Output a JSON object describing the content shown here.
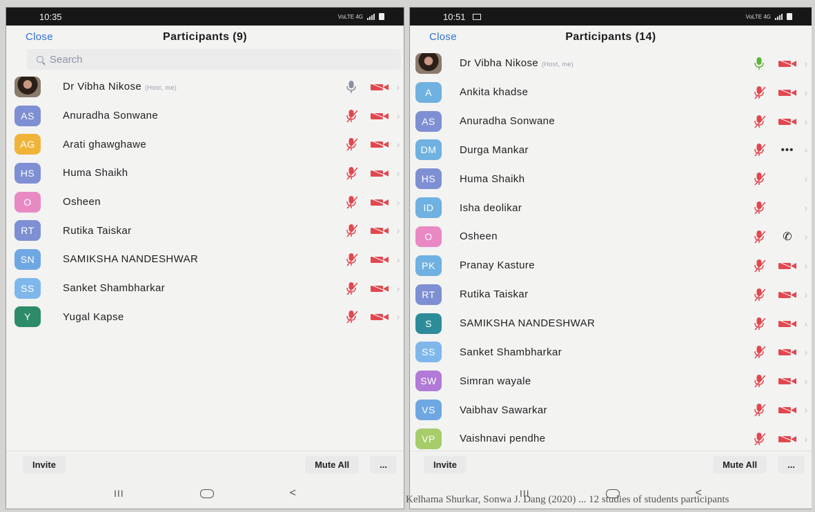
{
  "colors": {
    "accent": "#2f6fd0",
    "muted": "#e2474f",
    "mic_unmuted": "#8a8fa2",
    "mic_active": "#5fb23a"
  },
  "left": {
    "status": {
      "time": "10:35",
      "icons_text": "VoLTE 4G"
    },
    "header": {
      "close": "Close",
      "title": "Participants (9)"
    },
    "search": {
      "placeholder": "Search"
    },
    "participants": [
      {
        "initials": "",
        "photo": true,
        "name": "Dr Vibha Nikose",
        "note": "(Host, me)",
        "mic": "unmuted",
        "cam": true
      },
      {
        "initials": "AS",
        "color": "#7e8fd3",
        "name": "Anuradha Sonwane",
        "mic": "muted",
        "cam": true
      },
      {
        "initials": "AG",
        "color": "#f0b43a",
        "name": "Arati ghawghawe",
        "mic": "muted",
        "cam": true
      },
      {
        "initials": "HS",
        "color": "#7e8fd3",
        "name": "Huma Shaikh",
        "mic": "muted",
        "cam": true
      },
      {
        "initials": "O",
        "color": "#e889c4",
        "name": "Osheen",
        "mic": "muted",
        "cam": true
      },
      {
        "initials": "RT",
        "color": "#7e8fd3",
        "name": "Rutika Taiskar",
        "mic": "muted",
        "cam": true
      },
      {
        "initials": "SN",
        "color": "#6fa7e3",
        "name": "SAMIKSHA NANDESHWAR",
        "mic": "muted",
        "cam": true
      },
      {
        "initials": "SS",
        "color": "#7fb7ea",
        "name": "Sanket Shambharkar",
        "mic": "muted",
        "cam": true
      },
      {
        "initials": "Y",
        "color": "#2e8b6a",
        "name": "Yugal Kapse",
        "mic": "muted",
        "cam": true
      }
    ],
    "bottom": {
      "invite": "Invite",
      "mute_all": "Mute All",
      "more": "..."
    },
    "nav": {
      "recents": "III",
      "back": "<"
    }
  },
  "right": {
    "status": {
      "time": "10:51",
      "icons_text": "VoLTE 4G"
    },
    "header": {
      "close": "Close",
      "title": "Participants (14)"
    },
    "participants": [
      {
        "initials": "",
        "photo": true,
        "name": "Dr Vibha Nikose",
        "note": "(Host, me)",
        "mic": "active",
        "cam": true
      },
      {
        "initials": "A",
        "color": "#6fb1e0",
        "name": "Ankita  khadse",
        "mic": "muted",
        "cam": true
      },
      {
        "initials": "AS",
        "color": "#7e8fd3",
        "name": "Anuradha Sonwane",
        "mic": "muted",
        "cam": true
      },
      {
        "initials": "DM",
        "color": "#6fb1e0",
        "name": "Durga Mankar",
        "mic": "muted",
        "cam": false,
        "extra": "dots"
      },
      {
        "initials": "HS",
        "color": "#7e8fd3",
        "name": "Huma Shaikh",
        "mic": "muted",
        "cam": false
      },
      {
        "initials": "ID",
        "color": "#6fb1e0",
        "name": "Isha deolikar",
        "mic": "muted",
        "cam": false
      },
      {
        "initials": "O",
        "color": "#e889c4",
        "name": "Osheen",
        "mic": "muted",
        "cam": false,
        "extra": "phone"
      },
      {
        "initials": "PK",
        "color": "#6fb1e0",
        "name": "Pranay Kasture",
        "mic": "muted",
        "cam": true
      },
      {
        "initials": "RT",
        "color": "#7e8fd3",
        "name": "Rutika Taiskar",
        "mic": "muted",
        "cam": true
      },
      {
        "initials": "S",
        "color": "#2e8b9a",
        "name": "SAMIKSHA NANDESHWAR",
        "mic": "muted",
        "cam": true
      },
      {
        "initials": "SS",
        "color": "#7fb7ea",
        "name": "Sanket Shambharkar",
        "mic": "muted",
        "cam": true
      },
      {
        "initials": "SW",
        "color": "#b07ad6",
        "name": "Simran wayale",
        "mic": "muted",
        "cam": true
      },
      {
        "initials": "VS",
        "color": "#6fa7e3",
        "name": "Vaibhav Sawarkar",
        "mic": "muted",
        "cam": true
      },
      {
        "initials": "VP",
        "color": "#a6cd6a",
        "name": "Vaishnavi pendhe",
        "mic": "muted",
        "cam": true
      }
    ],
    "bottom": {
      "invite": "Invite",
      "mute_all": "Mute All",
      "more": "..."
    },
    "nav": {
      "recents": "III",
      "back": "<"
    }
  },
  "background_text": "Kelhama Shurkar, Sonwa J. Dang  (2020) ...   12 studies of students participants"
}
